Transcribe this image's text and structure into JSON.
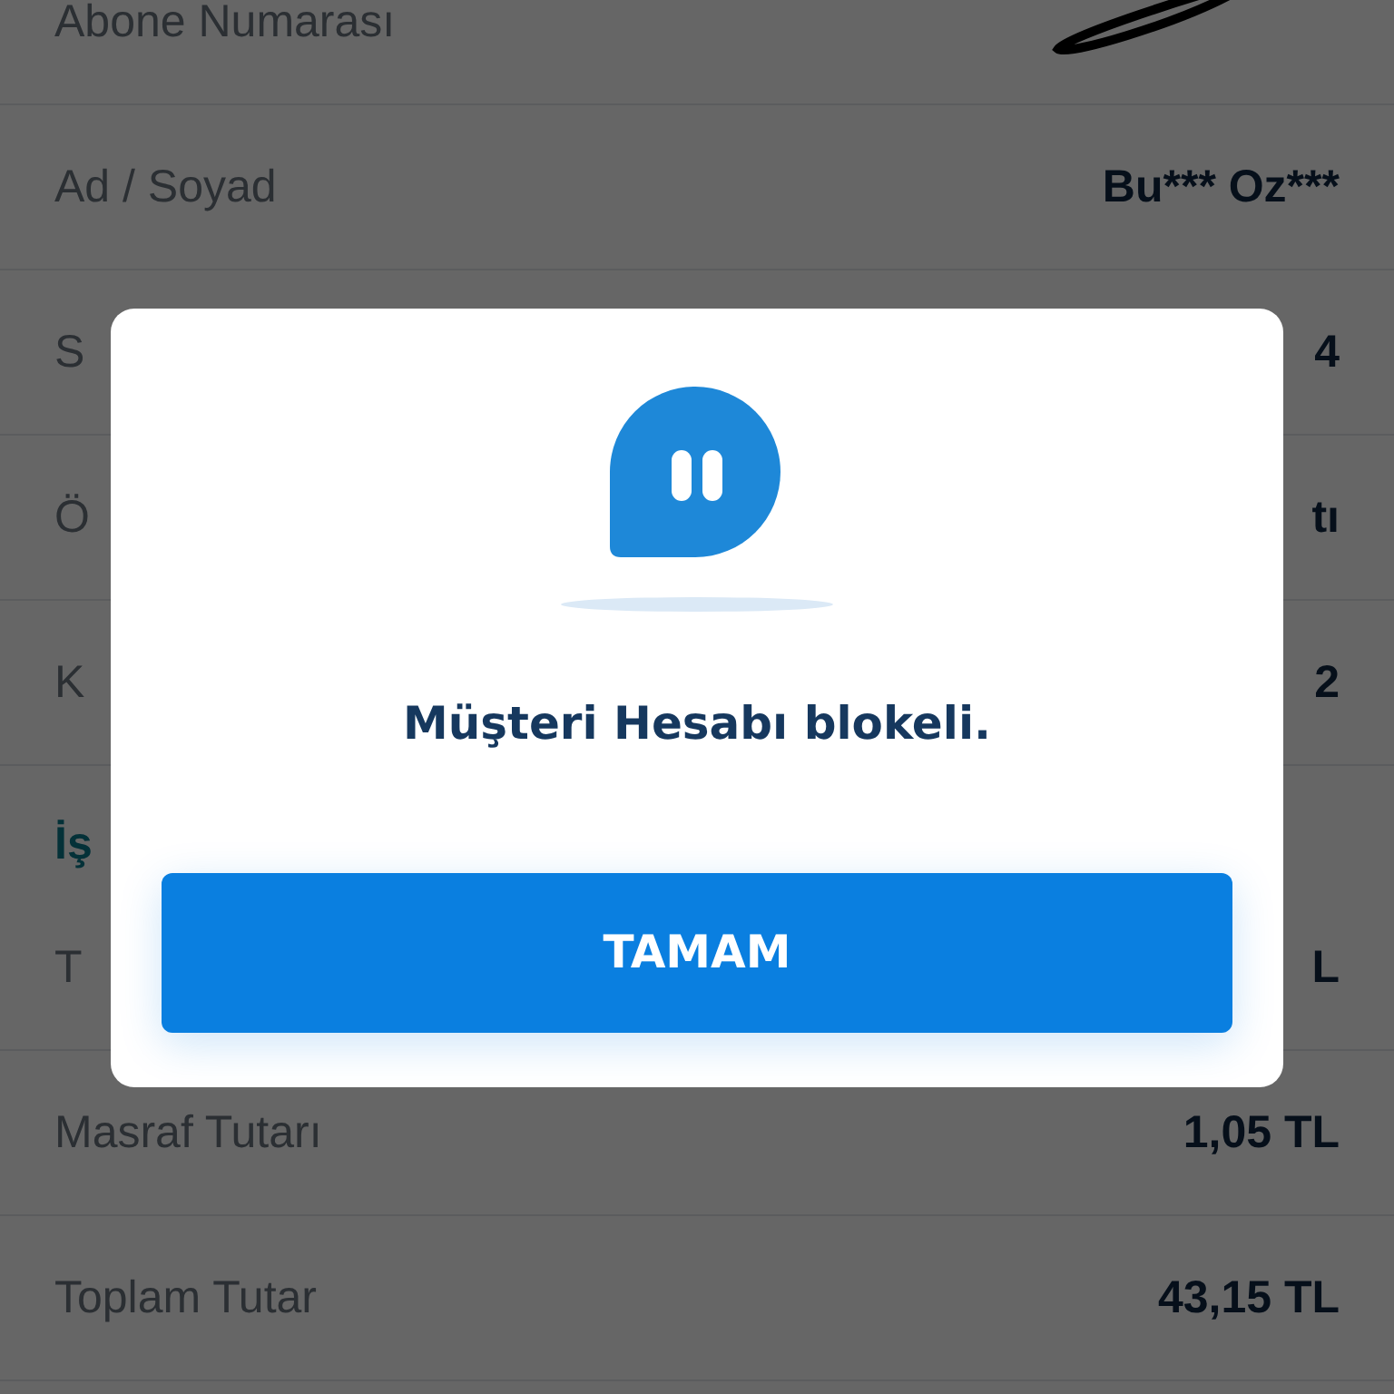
{
  "rows": [
    {
      "kind": "redacted",
      "label": "Abone Numarası"
    },
    {
      "kind": "row",
      "label": "Ad / Soyad",
      "value": "Bu*** Oz***"
    },
    {
      "kind": "row",
      "label": "S",
      "value": "4"
    },
    {
      "kind": "row",
      "label": "Ö",
      "value": "tı"
    },
    {
      "kind": "row",
      "label": "K",
      "value": "2"
    },
    {
      "kind": "section",
      "label": "İş"
    },
    {
      "kind": "row",
      "label": "T",
      "value": "L"
    },
    {
      "kind": "row",
      "label": "Masraf Tutarı",
      "value": "1,05 TL"
    },
    {
      "kind": "row",
      "label": "Toplam Tutar",
      "value": "43,15 TL"
    }
  ],
  "dialog": {
    "message": "Müşteri Hesabı blokeli.",
    "button": "TAMAM"
  }
}
